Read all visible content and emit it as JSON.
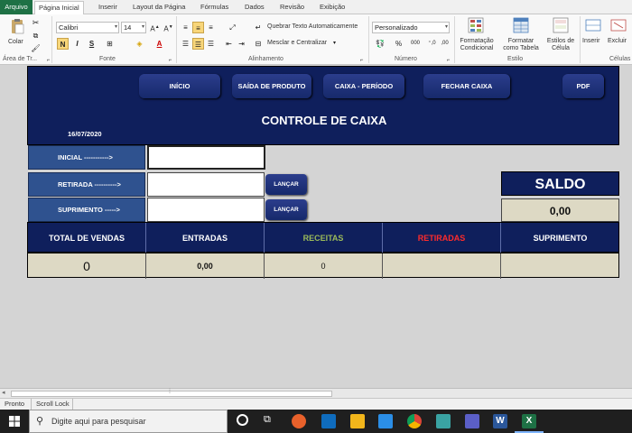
{
  "ribbon": {
    "tabs": [
      "Arquivo",
      "Página Inicial",
      "Inserir",
      "Layout da Página",
      "Fórmulas",
      "Dados",
      "Revisão",
      "Exibição"
    ],
    "colar": "Colar",
    "font_name": "Calibri",
    "font_size": "14",
    "wrap_text": "Quebrar Texto Automaticamente",
    "merge_center": "Mesclar e Centralizar",
    "number_format": "Personalizado",
    "cond_format": [
      "Formatação",
      "Condicional"
    ],
    "format_table": [
      "Formatar",
      "como Tabela"
    ],
    "cell_styles": [
      "Estilos de",
      "Célula"
    ],
    "insert": "Inserir",
    "delete": "Excluir",
    "groups": [
      "Área de Tr...",
      "Fonte",
      "Alinhamento",
      "Número",
      "Estilo",
      "Células"
    ],
    "bold": "N",
    "italic": "I",
    "underline": "S",
    "percent": "%",
    "thousands": "000",
    "accent": "#1e7145"
  },
  "sheet": {
    "nav_buttons": [
      "INÍCIO",
      "SAÍDA DE PRODUTO",
      "CAIXA - PERÍODO",
      "FECHAR CAIXA",
      "PDF"
    ],
    "title": "CONTROLE DE CAIXA",
    "date": "16/07/2020",
    "inicial_label": "INICIAL ----------->",
    "retirada_label": "RETIRADA ---------->",
    "suprimento_label": "SUPRIMENTO ----->",
    "lancar": "LANÇAR",
    "saldo_label": "SALDO",
    "saldo_value": "0,00",
    "table_headers": [
      {
        "label": "TOTAL DE VENDAS",
        "color": "#ffffff"
      },
      {
        "label": "ENTRADAS",
        "color": "#ffffff"
      },
      {
        "label": "RECEITAS",
        "color": "#9bbb59"
      },
      {
        "label": "RETIRADAS",
        "color": "#ff2b2b"
      },
      {
        "label": "SUPRIMENTO",
        "color": "#ffffff"
      }
    ],
    "table_values": [
      "0",
      "0,00",
      "0",
      "",
      ""
    ],
    "panel_color": "#0f1f5c"
  },
  "status": {
    "ready": "Pronto",
    "scroll_lock": "Scroll Lock"
  },
  "taskbar": {
    "search_placeholder": "Digite aqui para pesquisar"
  }
}
